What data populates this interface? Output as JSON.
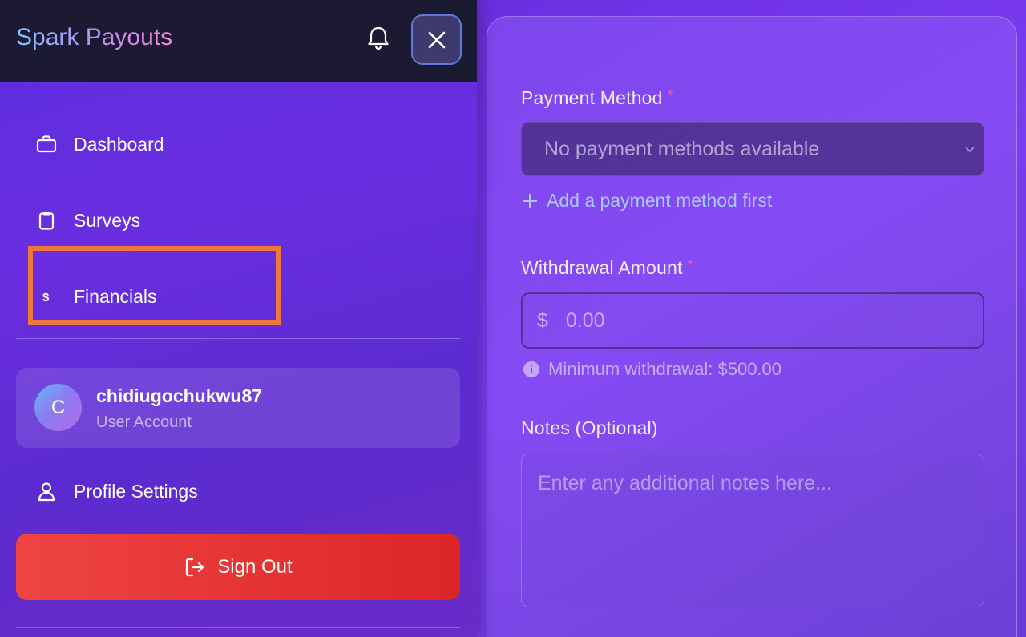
{
  "app": {
    "title": "Spark Payouts"
  },
  "header": {
    "notifications_icon": "bell-icon",
    "close_icon": "close-icon"
  },
  "sidebar": {
    "items": [
      {
        "label": "Dashboard",
        "icon": "briefcase-icon"
      },
      {
        "label": "Surveys",
        "icon": "clipboard-icon"
      },
      {
        "label": "Financials",
        "icon": "dollar-icon",
        "highlighted": true
      }
    ],
    "user": {
      "avatar_initial": "C",
      "name": "chidiugochukwu87",
      "type": "User Account"
    },
    "profile_settings_label": "Profile Settings",
    "sign_out_label": "Sign Out"
  },
  "form": {
    "payment_method": {
      "label": "Payment Method",
      "required_mark": "*",
      "selected": "No payment methods available",
      "add_link": "Add a payment method first"
    },
    "withdrawal_amount": {
      "label": "Withdrawal Amount",
      "required_mark": "*",
      "currency": "$",
      "placeholder": "0.00",
      "hint": "Minimum withdrawal: $500.00"
    },
    "notes": {
      "label": "Notes (Optional)",
      "placeholder": "Enter any additional notes here..."
    }
  },
  "colors": {
    "accent": "#7c3aed",
    "highlight_border": "#f0763c",
    "sign_out": "#dc2626",
    "required": "#ff5a7a",
    "link": "#a9c9ff"
  }
}
